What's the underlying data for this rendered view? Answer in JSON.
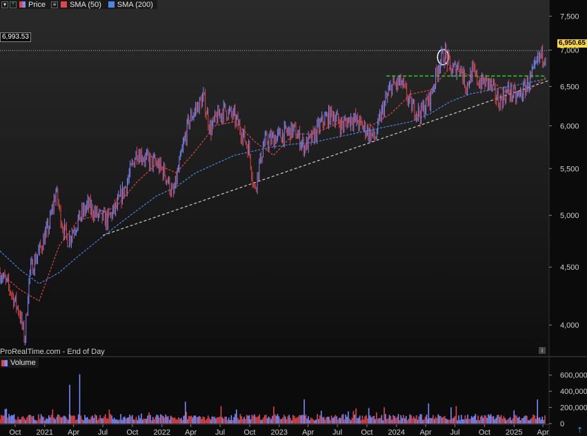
{
  "legend": {
    "price_label": "Price",
    "sma50_label": "SMA (50)",
    "sma200_label": "SMA (200)"
  },
  "source_label": "ProRealTime.com - End of Day",
  "volume_label": "Volume",
  "value_tags": {
    "left": "6,993.53",
    "right": "6,950.65"
  },
  "colors": {
    "up": "#7a8cff",
    "down": "#e0464a",
    "sma50": "#e0464a",
    "sma200": "#4a88e8",
    "support_trend": "#cfcfcf",
    "resistance": "#22cc22",
    "ref_line": "#bbbbbb",
    "highlight_circle": "#ffffff"
  },
  "chart_data": {
    "type": "line",
    "y_scale": "log",
    "ylim": [
      3750,
      7600
    ],
    "y_ticks": [
      4000,
      4500,
      5000,
      5500,
      6000,
      6500,
      7000,
      7500
    ],
    "y_tick_labels": [
      "4,000",
      "4,500",
      "5,000",
      "5,500",
      "6,000",
      "6,500",
      "7,000",
      "7,500"
    ],
    "x_ticks": [
      "2020-10-01",
      "2021-01-01",
      "2021-04-01",
      "2021-07-01",
      "2021-10-01",
      "2022-01-01",
      "2022-04-01",
      "2022-07-01",
      "2022-10-01",
      "2023-01-01",
      "2023-04-01",
      "2023-07-01",
      "2023-10-01",
      "2024-01-01",
      "2024-04-01",
      "2024-07-01",
      "2024-10-01",
      "2025-01-01",
      "2025-04-01"
    ],
    "x_tick_labels": [
      "Oct",
      "2021",
      "Apr",
      "Jul",
      "Oct",
      "2022",
      "Apr",
      "Jul",
      "Oct",
      "2023",
      "Apr",
      "Jul",
      "Oct",
      "2024",
      "Apr",
      "Jul",
      "Oct",
      "2025",
      "Apr"
    ],
    "xlim": [
      "2020-08-15",
      "2025-04-20"
    ],
    "price": {
      "dates": [
        "2020-08-15",
        "2020-09-15",
        "2020-10-15",
        "2020-10-31",
        "2020-11-15",
        "2020-12-15",
        "2021-01-15",
        "2021-02-05",
        "2021-02-25",
        "2021-03-15",
        "2021-04-15",
        "2021-05-15",
        "2021-06-15",
        "2021-07-15",
        "2021-08-15",
        "2021-09-15",
        "2021-10-15",
        "2021-11-15",
        "2021-12-15",
        "2022-01-10",
        "2022-02-05",
        "2022-03-08",
        "2022-03-25",
        "2022-04-15",
        "2022-05-10",
        "2022-06-01",
        "2022-06-20",
        "2022-07-15",
        "2022-08-15",
        "2022-09-10",
        "2022-09-30",
        "2022-10-15",
        "2022-11-15",
        "2022-12-15",
        "2023-01-15",
        "2023-02-15",
        "2023-03-20",
        "2023-04-15",
        "2023-05-15",
        "2023-06-15",
        "2023-07-15",
        "2023-08-15",
        "2023-09-15",
        "2023-10-27",
        "2023-11-15",
        "2023-12-15",
        "2024-01-15",
        "2024-02-15",
        "2024-03-15",
        "2024-04-15",
        "2024-05-15",
        "2024-06-01",
        "2024-06-20",
        "2024-07-15",
        "2024-08-05",
        "2024-08-25",
        "2024-09-15",
        "2024-10-15",
        "2024-11-15",
        "2024-12-15",
        "2025-01-10",
        "2025-02-01",
        "2025-02-20",
        "2025-03-05",
        "2025-03-20",
        "2025-04-10"
      ],
      "values": [
        4450,
        4300,
        4100,
        3880,
        4450,
        4650,
        4900,
        5250,
        4900,
        4750,
        4950,
        5100,
        5000,
        4950,
        5100,
        5350,
        5700,
        5600,
        5550,
        5450,
        5200,
        5750,
        6050,
        6200,
        6350,
        5950,
        6100,
        6200,
        6100,
        5900,
        5700,
        5250,
        5800,
        5850,
        5900,
        5950,
        5750,
        5850,
        6050,
        6150,
        6000,
        6100,
        6000,
        5850,
        6150,
        6500,
        6550,
        6250,
        6150,
        6350,
        6850,
        6950,
        6700,
        6800,
        6500,
        6700,
        6550,
        6550,
        6300,
        6450,
        6350,
        6450,
        6600,
        6700,
        6900,
        6950
      ]
    },
    "sma50": {
      "dates": [
        "2020-08-15",
        "2020-10-15",
        "2020-12-15",
        "2021-02-15",
        "2021-04-15",
        "2021-06-15",
        "2021-08-15",
        "2021-10-15",
        "2021-12-15",
        "2022-02-15",
        "2022-04-15",
        "2022-06-15",
        "2022-08-15",
        "2022-10-20",
        "2022-12-15",
        "2023-02-15",
        "2023-04-15",
        "2023-06-15",
        "2023-08-15",
        "2023-10-15",
        "2023-12-15",
        "2024-02-15",
        "2024-04-15",
        "2024-06-15",
        "2024-08-15",
        "2024-10-15",
        "2024-12-15",
        "2025-02-15",
        "2025-04-10"
      ],
      "values": [
        4450,
        4300,
        4200,
        4700,
        4950,
        5000,
        5100,
        5350,
        5550,
        5450,
        5700,
        6000,
        6050,
        5800,
        5650,
        5900,
        5900,
        6000,
        6100,
        6000,
        6150,
        6400,
        6450,
        6750,
        6650,
        6600,
        6400,
        6450,
        6620
      ]
    },
    "sma200": {
      "dates": [
        "2020-08-15",
        "2020-10-15",
        "2020-12-15",
        "2021-02-15",
        "2021-04-15",
        "2021-06-15",
        "2021-08-15",
        "2021-10-15",
        "2021-12-15",
        "2022-02-15",
        "2022-04-15",
        "2022-06-15",
        "2022-08-15",
        "2022-10-15",
        "2022-12-15",
        "2023-02-15",
        "2023-04-15",
        "2023-06-15",
        "2023-08-15",
        "2023-10-15",
        "2023-12-15",
        "2024-02-15",
        "2024-04-15",
        "2024-06-15",
        "2024-08-15",
        "2024-10-15",
        "2024-12-15",
        "2025-02-15",
        "2025-04-10"
      ],
      "values": [
        4650,
        4480,
        4350,
        4450,
        4600,
        4750,
        4900,
        5050,
        5200,
        5300,
        5450,
        5550,
        5650,
        5700,
        5750,
        5780,
        5800,
        5850,
        5900,
        5950,
        6000,
        6050,
        6150,
        6300,
        6400,
        6450,
        6500,
        6550,
        6600
      ]
    },
    "volume": {
      "ylim": [
        0,
        700000
      ],
      "y_ticks": [
        0,
        200000,
        400000,
        600000
      ],
      "y_tick_labels": [
        "0",
        "200,000",
        "400,000",
        "600,000"
      ],
      "spikes": [
        {
          "date": "2021-03-20",
          "value": 480000
        },
        {
          "date": "2021-04-20",
          "value": 610000
        },
        {
          "date": "2022-03-15",
          "value": 270000
        },
        {
          "date": "2023-03-20",
          "value": 300000
        },
        {
          "date": "2024-04-10",
          "value": 250000
        },
        {
          "date": "2025-03-15",
          "value": 300000
        }
      ]
    },
    "annotations": {
      "support_trendline": {
        "from": [
          "2021-07-01",
          4800
        ],
        "to": [
          "2025-04-20",
          6580
        ]
      },
      "resistance_line": {
        "from": [
          "2023-12-01",
          6640
        ],
        "to": [
          "2025-04-10",
          6640
        ]
      },
      "ref_line_value": 6993.53,
      "circle_marker": {
        "date": "2024-05-25",
        "value": 6900
      }
    }
  }
}
